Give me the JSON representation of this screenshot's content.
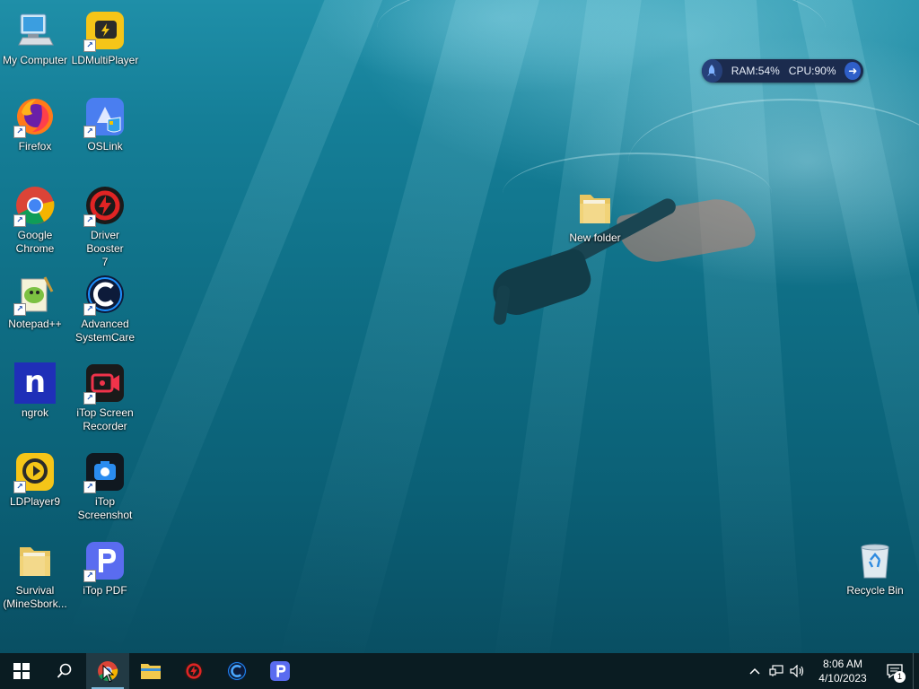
{
  "desktop": {
    "icons": [
      {
        "label": "My Computer",
        "icon": "computer-icon"
      },
      {
        "label": "LDMultiPlayer",
        "icon": "ldmultiplayer-icon"
      },
      {
        "label": "Firefox",
        "icon": "firefox-icon"
      },
      {
        "label": "OSLink",
        "icon": "oslink-icon"
      },
      {
        "label": "Google\nChrome",
        "icon": "chrome-icon"
      },
      {
        "label": "Driver Booster\n7",
        "icon": "driver-booster-icon"
      },
      {
        "label": "Notepad++",
        "icon": "notepadpp-icon"
      },
      {
        "label": "Advanced\nSystemCare",
        "icon": "advanced-systemcare-icon"
      },
      {
        "label": "ngrok",
        "icon": "ngrok-icon"
      },
      {
        "label": "iTop Screen\nRecorder",
        "icon": "itop-screen-recorder-icon"
      },
      {
        "label": "LDPlayer9",
        "icon": "ldplayer9-icon"
      },
      {
        "label": "iTop\nScreenshot",
        "icon": "itop-screenshot-icon"
      },
      {
        "label": "Survival\n(MineSbork...",
        "icon": "folder-icon"
      },
      {
        "label": "iTop PDF",
        "icon": "itop-pdf-icon"
      },
      {
        "label": "New folder",
        "icon": "folder-icon"
      },
      {
        "label": "Recycle Bin",
        "icon": "recycle-bin-icon"
      }
    ]
  },
  "widget": {
    "ram": "RAM:54%",
    "cpu": "CPU:90%"
  },
  "taskbar": {
    "apps": [
      "start-icon",
      "search-icon",
      "chrome-icon",
      "file-explorer-icon",
      "driver-booster-icon",
      "advanced-systemcare-icon",
      "itop-pdf-icon"
    ],
    "time": "8:06 AM",
    "date": "4/10/2023",
    "notification_count": "1"
  }
}
